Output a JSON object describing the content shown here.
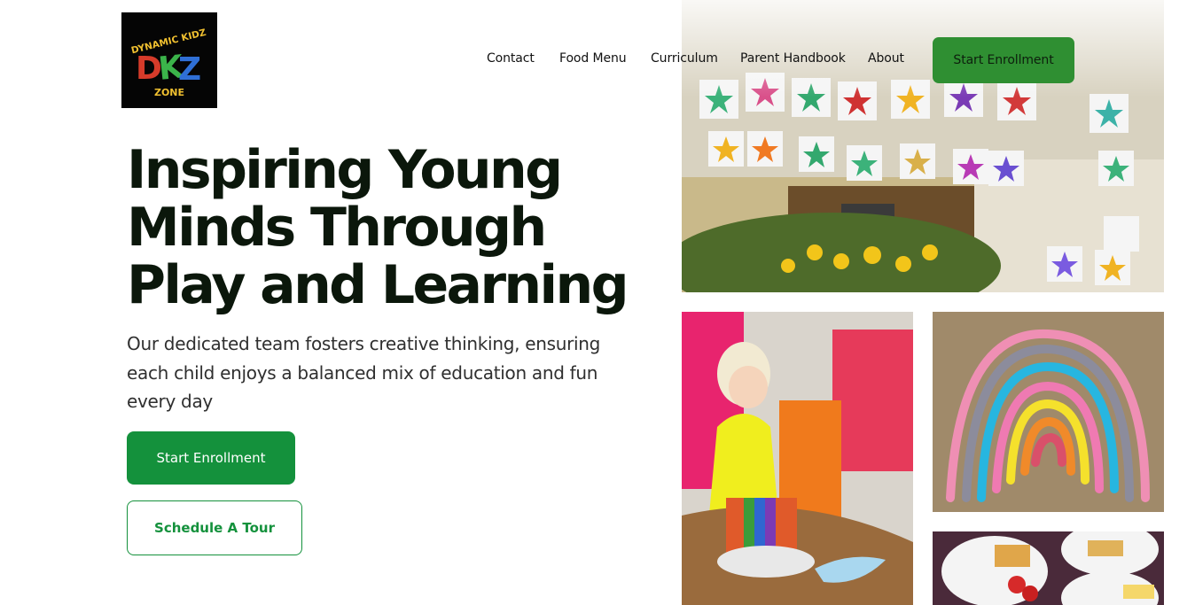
{
  "brand": {
    "logo_line1": "DYNAMIC KIDZ",
    "logo_letters": "DKZ",
    "logo_line2": "ZONE"
  },
  "nav": {
    "items": [
      {
        "label": "Contact"
      },
      {
        "label": "Food Menu"
      },
      {
        "label": "Curriculum"
      },
      {
        "label": "Parent Handbook"
      },
      {
        "label": "About"
      }
    ],
    "cta_label": "Start Enrollment"
  },
  "hero": {
    "title": "Inspiring Young Minds Through Play and Learning",
    "subtitle": "Our dedicated team fosters creative thinking, ensuring each child enjoys a balanced mix of education and fun every day",
    "primary_button": "Start Enrollment",
    "secondary_button": "Schedule A Tour"
  },
  "colors": {
    "accent_green": "#14913c",
    "nav_cta_green": "#2f8f32"
  }
}
